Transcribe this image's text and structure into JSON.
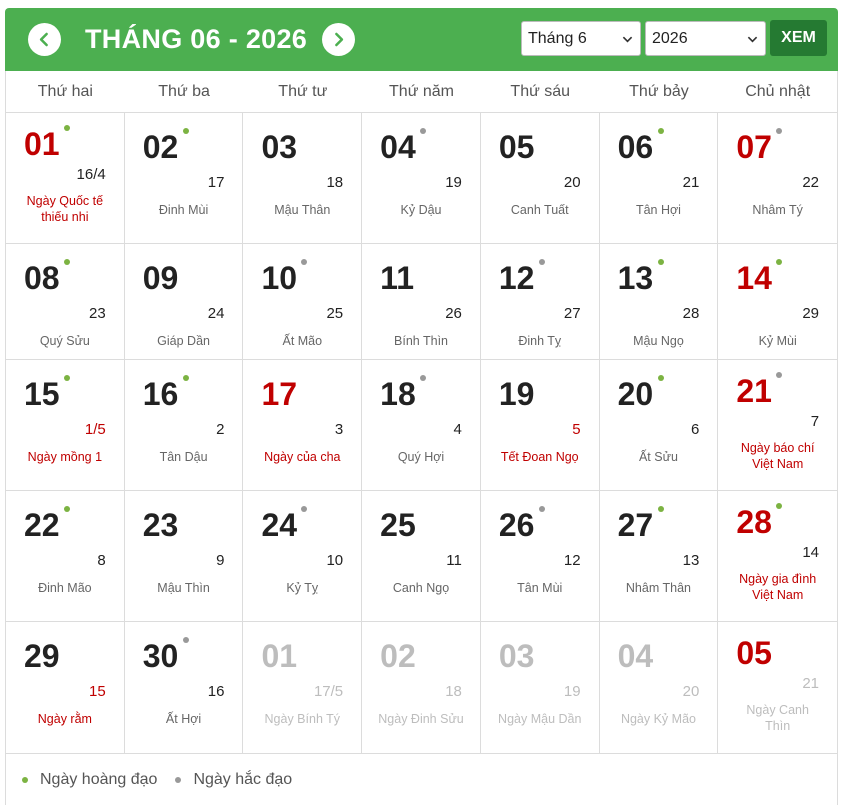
{
  "header": {
    "title": "THÁNG 06 - 2026",
    "month_select": "Tháng 6",
    "year_select": "2026",
    "go_label": "XEM",
    "bg_color": "#4caf50"
  },
  "weekdays": [
    "Thứ hai",
    "Thứ ba",
    "Thứ tư",
    "Thứ năm",
    "Thứ sáu",
    "Thứ bảy",
    "Chủ nhật"
  ],
  "weeks": [
    {
      "height": 131,
      "days": [
        {
          "day": "01",
          "lunar": "16/4",
          "text": "Ngày Quốc tế thiếu nhi",
          "dot": "good",
          "red": true,
          "holiday": true
        },
        {
          "day": "02",
          "lunar": "17",
          "text": "Đinh Mùi",
          "dot": "good"
        },
        {
          "day": "03",
          "lunar": "18",
          "text": "Mậu Thân",
          "dot": ""
        },
        {
          "day": "04",
          "lunar": "19",
          "text": "Kỷ Dậu",
          "dot": "bad"
        },
        {
          "day": "05",
          "lunar": "20",
          "text": "Canh Tuất",
          "dot": ""
        },
        {
          "day": "06",
          "lunar": "21",
          "text": "Tân Hợi",
          "dot": "good"
        },
        {
          "day": "07",
          "lunar": "22",
          "text": "Nhâm Tý",
          "dot": "bad",
          "red": true
        }
      ]
    },
    {
      "height": 116,
      "days": [
        {
          "day": "08",
          "lunar": "23",
          "text": "Quý Sửu",
          "dot": "good"
        },
        {
          "day": "09",
          "lunar": "24",
          "text": "Giáp Dần",
          "dot": ""
        },
        {
          "day": "10",
          "lunar": "25",
          "text": "Ất Mão",
          "dot": "bad"
        },
        {
          "day": "11",
          "lunar": "26",
          "text": "Bính Thìn",
          "dot": ""
        },
        {
          "day": "12",
          "lunar": "27",
          "text": "Đinh Tỵ",
          "dot": "bad"
        },
        {
          "day": "13",
          "lunar": "28",
          "text": "Mậu Ngọ",
          "dot": "good"
        },
        {
          "day": "14",
          "lunar": "29",
          "text": "Kỷ Mùi",
          "dot": "good",
          "red": true
        }
      ]
    },
    {
      "height": 131,
      "days": [
        {
          "day": "15",
          "lunar": "1/5",
          "text": "Ngày mồng 1",
          "dot": "good",
          "lunar_red": true,
          "holiday": true
        },
        {
          "day": "16",
          "lunar": "2",
          "text": "Tân Dậu",
          "dot": "good"
        },
        {
          "day": "17",
          "lunar": "3",
          "text": "Ngày của cha",
          "dot": "",
          "red": true,
          "holiday": true
        },
        {
          "day": "18",
          "lunar": "4",
          "text": "Quý Hợi",
          "dot": "bad"
        },
        {
          "day": "19",
          "lunar": "5",
          "text": "Tết Đoan Ngọ",
          "dot": "",
          "lunar_red": true,
          "holiday": true
        },
        {
          "day": "20",
          "lunar": "6",
          "text": "Ất Sửu",
          "dot": "good"
        },
        {
          "day": "21",
          "lunar": "7",
          "text": "Ngày báo chí Việt Nam",
          "dot": "bad",
          "red": true,
          "holiday": true
        }
      ]
    },
    {
      "height": 131,
      "days": [
        {
          "day": "22",
          "lunar": "8",
          "text": "Đinh Mão",
          "dot": "good"
        },
        {
          "day": "23",
          "lunar": "9",
          "text": "Mậu Thìn",
          "dot": ""
        },
        {
          "day": "24",
          "lunar": "10",
          "text": "Kỷ Tỵ",
          "dot": "bad"
        },
        {
          "day": "25",
          "lunar": "11",
          "text": "Canh Ngọ",
          "dot": ""
        },
        {
          "day": "26",
          "lunar": "12",
          "text": "Tân Mùi",
          "dot": "bad"
        },
        {
          "day": "27",
          "lunar": "13",
          "text": "Nhâm Thân",
          "dot": "good"
        },
        {
          "day": "28",
          "lunar": "14",
          "text": "Ngày gia đình Việt Nam",
          "dot": "good",
          "red": true,
          "holiday": true
        }
      ]
    },
    {
      "height": 132,
      "days": [
        {
          "day": "29",
          "lunar": "15",
          "text": "Ngày rằm",
          "dot": "",
          "lunar_red": true,
          "holiday": true
        },
        {
          "day": "30",
          "lunar": "16",
          "text": "Ất Hợi",
          "dot": "bad"
        },
        {
          "day": "01",
          "lunar": "17/5",
          "text": "Ngày Bính Tý",
          "dot": "",
          "other": true
        },
        {
          "day": "02",
          "lunar": "18",
          "text": "Ngày Đinh Sửu",
          "dot": "",
          "other": true
        },
        {
          "day": "03",
          "lunar": "19",
          "text": "Ngày Mậu Dần",
          "dot": "",
          "other": true
        },
        {
          "day": "04",
          "lunar": "20",
          "text": "Ngày Kỷ Mão",
          "dot": "",
          "other": true
        },
        {
          "day": "05",
          "lunar": "21",
          "text": "Ngày Canh Thìn",
          "dot": "",
          "other": true,
          "red": true
        }
      ]
    }
  ],
  "legend": {
    "good_label": "Ngày hoàng đạo",
    "bad_label": "Ngày hắc đạo",
    "good_color": "#7cb342",
    "bad_color": "#999999"
  }
}
